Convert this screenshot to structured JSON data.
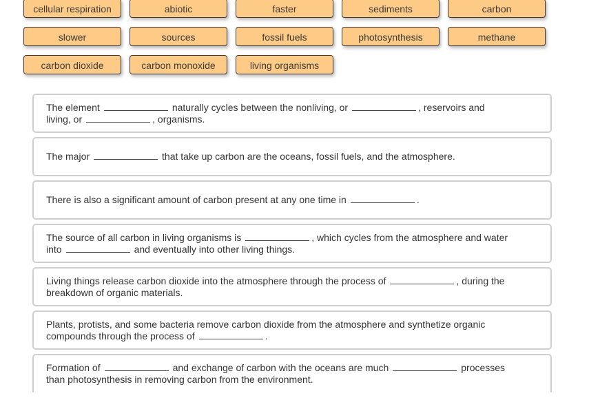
{
  "word_bank": {
    "chips": [
      {
        "label": "cellular respiration",
        "color": "#fecb86"
      },
      {
        "label": "abiotic",
        "color": "#fecb86"
      },
      {
        "label": "faster",
        "color": "#fecb86"
      },
      {
        "label": "sediments",
        "color": "#fecb86"
      },
      {
        "label": "carbon",
        "color": "#fecb86"
      },
      {
        "label": "slower",
        "color": "#fecb86"
      },
      {
        "label": "sources",
        "color": "#fecb86"
      },
      {
        "label": "fossil fuels",
        "color": "#fecb86"
      },
      {
        "label": "photosynthesis",
        "color": "#fecb86"
      },
      {
        "label": "methane",
        "color": "#fecb86"
      },
      {
        "label": "carbon dioxide",
        "color": "#fecb86"
      },
      {
        "label": "carbon monoxide",
        "color": "#fecb86"
      },
      {
        "label": "living organisms",
        "color": "#fecb86"
      }
    ]
  },
  "sentences": [
    {
      "parts": [
        "The element",
        "naturally cycles between the nonliving, or",
        ", reservoirs and",
        "living, or",
        ", organisms."
      ],
      "blanks": [
        "",
        "",
        ""
      ]
    },
    {
      "parts": [
        "The major",
        "that take up carbon are the oceans, fossil fuels, and the atmosphere."
      ],
      "blanks": [
        ""
      ]
    },
    {
      "parts": [
        "There is also a significant amount of carbon present at any one time in",
        "."
      ],
      "blanks": [
        ""
      ]
    },
    {
      "parts": [
        "The source of all carbon in living organisms is",
        ", which cycles from the atmosphere and water",
        "into",
        "and eventually into other living things."
      ],
      "blanks": [
        "",
        ""
      ]
    },
    {
      "parts": [
        "Living things release carbon dioxide into the atmosphere through the process of",
        ", during the",
        "breakdown of organic materials."
      ],
      "blanks": [
        ""
      ]
    },
    {
      "parts": [
        "Plants, protists, and some bacteria remove carbon dioxide from the atmosphere and synthetize organic",
        "compounds through the process of",
        "."
      ],
      "blanks": [
        ""
      ]
    },
    {
      "parts": [
        "Formation of",
        "and exchange of carbon with the oceans are much",
        "processes",
        "than photosynthesis in removing carbon from the environment."
      ],
      "blanks": [
        "",
        ""
      ]
    }
  ]
}
